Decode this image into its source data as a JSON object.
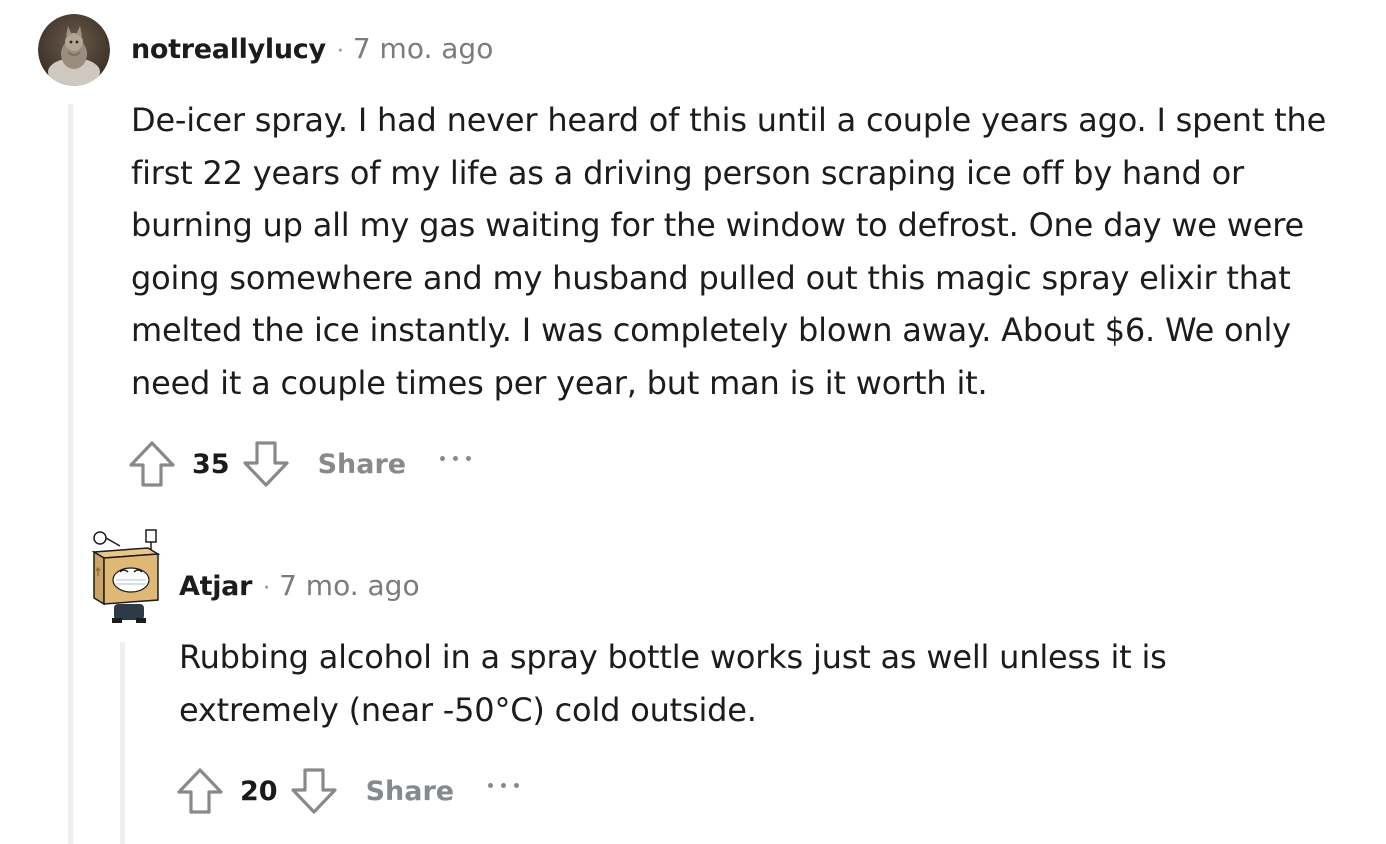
{
  "comments": [
    {
      "username": "notreallylucy",
      "separator": "·",
      "time": "7 mo. ago",
      "body_lines": [
        "De-icer spray. I had never heard of this until a couple years ago. I spent the",
        "first 22 years of my life as a driving person scraping ice off by hand or",
        "burning up all my gas waiting for the window to defrost. One day we were",
        "going somewhere and my husband pulled out this magic spray elixir that",
        "melted the ice instantly. I was completely blown away. About $6. We only",
        "need it a couple times per year, but man is it worth it."
      ],
      "votes": "35",
      "share_label": "Share",
      "avatar_icon": "cat-avatar"
    },
    {
      "username": "Atjar",
      "separator": "·",
      "time": "7 mo. ago",
      "body_lines": [
        "Rubbing alcohol in a spray bottle works just as well unless it is",
        "extremely (near -50°C) cold outside."
      ],
      "votes": "20",
      "share_label": "Share",
      "avatar_icon": "box-head-avatar"
    }
  ],
  "colors": {
    "text": "#1c1c1c",
    "meta": "#7c7c7c",
    "icon": "#878a8c",
    "thread_line": "#edeff1"
  }
}
